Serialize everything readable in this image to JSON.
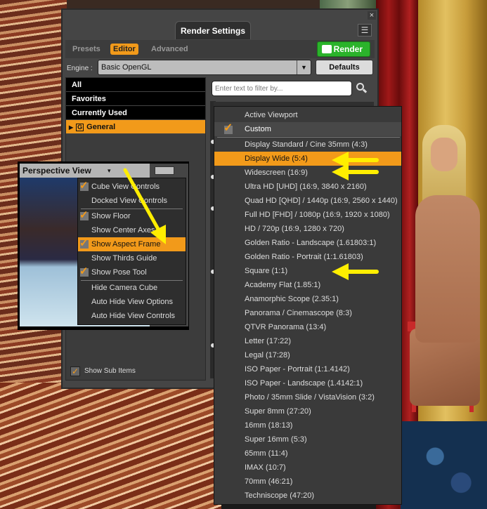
{
  "window": {
    "title": "Render Settings",
    "close_glyph": "×",
    "pane_menu_glyph": "☰",
    "tabs": [
      "Presets",
      "Editor",
      "Advanced"
    ],
    "active_tab": "Editor",
    "render_label": "Render",
    "engine_label": "Engine :",
    "engine_value": "Basic OpenGL",
    "defaults_label": "Defaults",
    "filter_placeholder": "Enter text to filter by...",
    "groups": [
      "All",
      "Favorites",
      "Currently Used"
    ],
    "general_group": {
      "icon_letter": "G",
      "label": "General"
    },
    "show_sub_items": "Show Sub Items",
    "show_sub_items_checked": true
  },
  "viewport": {
    "title": "Perspective View",
    "dropdown_glyph": "▾"
  },
  "view_menu": {
    "items": [
      {
        "label": "Cube View Controls",
        "checked": true
      },
      {
        "label": "Docked View Controls",
        "checked": false
      },
      {
        "label": "Show Floor",
        "checked": true
      },
      {
        "label": "Show Center Axes",
        "checked": false
      },
      {
        "label": "Show Aspect Frame",
        "checked": true,
        "selected": true
      },
      {
        "label": "Show Thirds Guide",
        "checked": false
      },
      {
        "label": "Show Pose Tool",
        "checked": true
      },
      {
        "label": "Hide Camera Cube",
        "checked": false
      },
      {
        "label": "Auto Hide View Options",
        "checked": false
      },
      {
        "label": "Auto Hide View Controls",
        "checked": false
      }
    ]
  },
  "aspect_menu": {
    "items": [
      "Active Viewport",
      "Custom",
      "Display Standard / Cine 35mm (4:3)",
      "Display Wide (5:4)",
      "Widescreen (16:9)",
      "Ultra HD [UHD] (16:9, 3840 x 2160)",
      "Quad HD [QHD] / 1440p (16:9, 2560 x 1440)",
      "Full HD [FHD] / 1080p (16:9, 1920 x 1080)",
      "HD / 720p (16:9, 1280 x 720)",
      "Golden Ratio - Landscape (1.61803:1)",
      "Golden Ratio - Portrait (1:1.61803)",
      "Square (1:1)",
      "Academy Flat (1.85:1)",
      "Anamorphic Scope (2.35:1)",
      "Panorama / Cinemascope (8:3)",
      "QTVR Panorama (13:4)",
      "Letter (17:22)",
      "Legal (17:28)",
      "ISO Paper - Portrait (1:1.4142)",
      "ISO Paper - Landscape (1.4142:1)",
      "Photo / 35mm Slide / VistaVision (3:2)",
      "Super 8mm (27:20)",
      "16mm (18:13)",
      "Super 16mm (5:3)",
      "65mm (11:4)",
      "IMAX (10:7)",
      "70mm (46:21)",
      "Techniscope (47:20)"
    ],
    "checked_item": "Custom",
    "highlighted_item": "Display Wide (5:4)"
  },
  "colors": {
    "accent": "#f29a1a",
    "render_green": "#2bb32b",
    "annotation_arrow": "#ffee00"
  },
  "annotations": [
    "arrow-to-show-aspect-frame",
    "arrow-to-display-wide",
    "arrow-to-widescreen",
    "arrow-to-square"
  ]
}
